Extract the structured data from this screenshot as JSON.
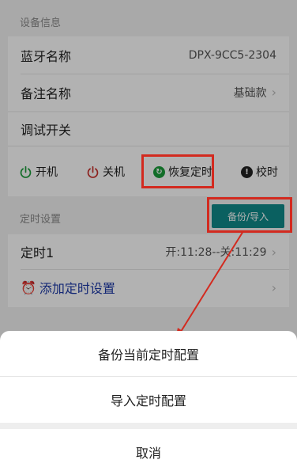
{
  "device_info": {
    "section_title": "设备信息",
    "bluetooth_name_label": "蓝牙名称",
    "bluetooth_name_value": "DPX-9CC5-2304",
    "remark_name_label": "备注名称",
    "remark_name_value": "基础款"
  },
  "debug_switch": {
    "title": "调试开关",
    "buttons": [
      {
        "label": "开机",
        "icon": "power-icon",
        "color": "#1a9c3a"
      },
      {
        "label": "关机",
        "icon": "power-icon",
        "color": "#c9302c"
      },
      {
        "label": "恢复定时",
        "icon": "restore-icon",
        "color": "#1a9c3a"
      },
      {
        "label": "校时",
        "icon": "clock-icon",
        "color": "#222222"
      }
    ]
  },
  "timer_settings": {
    "section_title": "定时设置",
    "backup_import_label": "备份/导入",
    "timer1_label": "定时1",
    "timer1_value": "开:11:28--关:11:29",
    "add_timer_label": "添加定时设置"
  },
  "action_sheet": {
    "backup_label": "备份当前定时配置",
    "import_label": "导入定时配置",
    "cancel_label": "取消"
  },
  "colors": {
    "accent_teal": "#0f8a8a",
    "highlight_red": "#d32a1f",
    "add_timer_blue": "#1e3aa8"
  }
}
